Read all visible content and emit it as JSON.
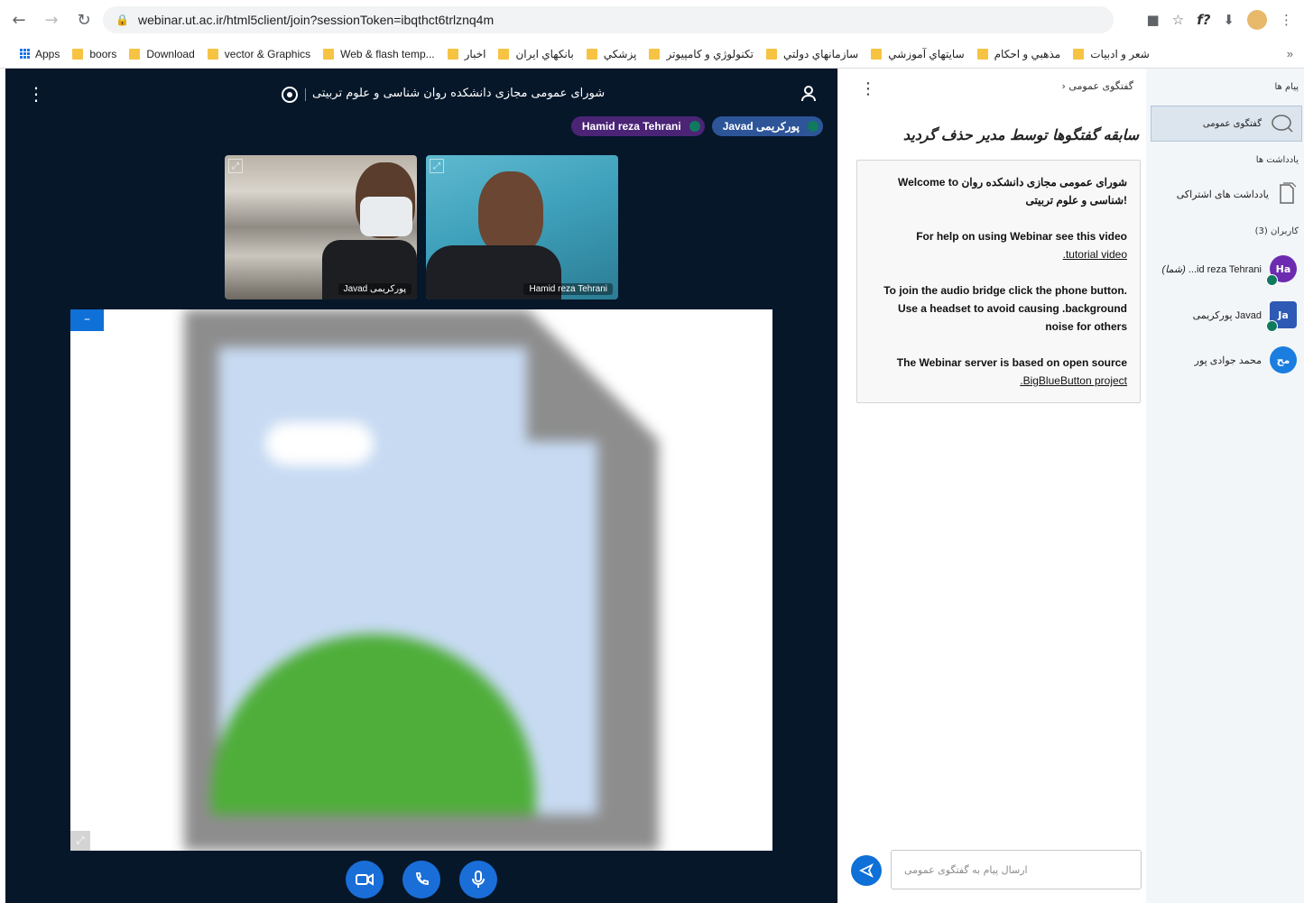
{
  "browser": {
    "url": "webinar.ut.ac.ir/html5client/join?sessionToken=ibqthct6trlznq4m",
    "bookmarks": [
      "Apps",
      "boors",
      "Download",
      "vector & Graphics",
      "Web & flash temp...",
      "اخبار",
      "بانکهاي ايران",
      "پزشکي",
      "تکنولوژي و کامپيوتر",
      "سازمانهاي دولتي",
      "سايتهاي آموزشي",
      "مذهبي و احکام",
      "شعر و ادبيات"
    ]
  },
  "meeting": {
    "title": "شورای عمومی مجازی دانشکده روان شناسی و علوم تربیتی",
    "talkers": [
      "Hamid reza Tehrani",
      "Javad پورکریمی"
    ],
    "videos": [
      "Javad پورکریمی",
      "Hamid reza Tehrani"
    ]
  },
  "chat": {
    "header": "گفتگوی عمومی",
    "cleared_notice": "سابقه گفتگوها توسط مدیر حذف گردید",
    "welcome": {
      "line1a": "Welcome to ",
      "line1b": "شورای عمومی مجازی دانشکده روان شناسی و علوم تربیتی!",
      "help": "For help on using Webinar see this video",
      "help_link": ".tutorial video",
      "audio": "To join the audio bridge click the phone button. Use a headset to avoid causing .background noise for others",
      "server": "The Webinar server is based on open source",
      "server_link": ".BigBlueButton project"
    },
    "placeholder": "ارسال پیام به گفتگوی عمومی"
  },
  "sidebar": {
    "messages_label": "پیام ها",
    "public_chat": "گفتگوی عمومی",
    "notes_label": "یادداشت ها",
    "shared_notes": "یادداشت های اشتراکی",
    "users_label": "کاربران (3)",
    "users": [
      {
        "initials": "Ha",
        "name": "id reza Tehrani...",
        "suffix": "(شما)"
      },
      {
        "initials": "Ja",
        "name": "Javad پورکریمی"
      },
      {
        "initials": "مح",
        "name": "محمد جوادی پور"
      }
    ]
  }
}
